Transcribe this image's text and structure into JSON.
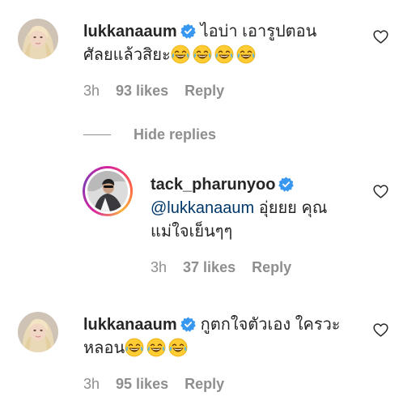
{
  "comments": [
    {
      "username": "lukkanaaum",
      "avatar_icon": "profile-photo-blonde",
      "verified": true,
      "line1": "ไอบ่า เอารูปตอน",
      "line2": "ศัลยแล้วสิยะ",
      "emoji": [
        "laughing-tears-emoji",
        "laughing-tears-emoji",
        "laughing-tears-emoji",
        "laughing-tears-emoji"
      ],
      "time": "3h",
      "likes": "93 likes",
      "reply_label": "Reply"
    },
    {
      "username": "tack_pharunyoo",
      "avatar_icon": "profile-photo-man-story-ring",
      "verified": true,
      "mention": "@lukkanaaum",
      "line1": " อุ่ยยย คุณ",
      "line2": "แม่ใจเย็นๆๆ",
      "time": "3h",
      "likes": "37 likes",
      "reply_label": "Reply"
    },
    {
      "username": "lukkanaaum",
      "avatar_icon": "profile-photo-blonde",
      "verified": true,
      "line1": "กูตกใจตัวเอง ใครวะ",
      "line2": "หลอน",
      "emoji": [
        "laughing-tears-emoji",
        "laughing-tears-emoji",
        "laughing-tears-emoji"
      ],
      "time": "3h",
      "likes": "95 likes",
      "reply_label": "Reply"
    }
  ],
  "hide_replies_label": "Hide replies",
  "colors": {
    "text": "#262626",
    "muted": "#8e8e8e",
    "mention": "#00376b",
    "verified": "#3897f0"
  }
}
